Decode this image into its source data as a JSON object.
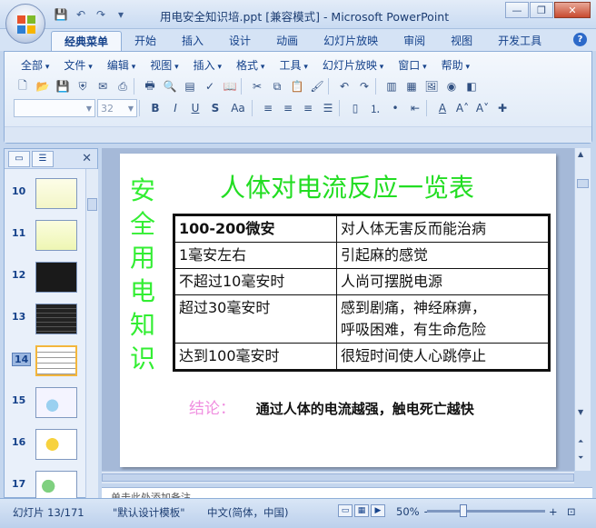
{
  "window": {
    "title": "用电安全知识培.ppt [兼容模式] - Microsoft PowerPoint"
  },
  "qat": {
    "save": "💾",
    "undo": "↶",
    "redo": "↷",
    "more": "▾"
  },
  "tabs": [
    "经典菜单",
    "开始",
    "插入",
    "设计",
    "动画",
    "幻灯片放映",
    "审阅",
    "视图",
    "开发工具"
  ],
  "menus": [
    "全部",
    "文件",
    "编辑",
    "视图",
    "插入",
    "格式",
    "工具",
    "幻灯片放映",
    "窗口",
    "帮助"
  ],
  "font_size_value": "32",
  "help": "?",
  "thumbnails": [
    {
      "num": "10",
      "selected": false,
      "style": "yellow"
    },
    {
      "num": "11",
      "selected": false,
      "style": "yellow"
    },
    {
      "num": "12",
      "selected": false,
      "style": "dark"
    },
    {
      "num": "13",
      "selected": false,
      "style": "dark-table"
    },
    {
      "num": "14",
      "selected": true,
      "style": "table"
    },
    {
      "num": "15",
      "selected": false,
      "style": "figure"
    },
    {
      "num": "16",
      "selected": false,
      "style": "figure2"
    },
    {
      "num": "17",
      "selected": false,
      "style": "figure3"
    }
  ],
  "slide": {
    "vertical_title": [
      "安",
      "全",
      "用",
      "电",
      "知",
      "识"
    ],
    "title": "人体对电流反应一览表",
    "table": [
      {
        "c1": "100-200微安",
        "c2": "对人体无害反而能治病",
        "bold": true
      },
      {
        "c1": "1毫安左右",
        "c2": "引起麻的感觉",
        "bold": false
      },
      {
        "c1": "不超过10毫安时",
        "c2": "人尚可摆脱电源",
        "bold": false
      },
      {
        "c1": "超过30毫安时",
        "c2": "感到剧痛，神经麻痹，",
        "c2b": "呼吸困难，有生命危险",
        "bold": false
      },
      {
        "c1": "达到100毫安时",
        "c2": "很短时间使人心跳停止",
        "bold": false
      }
    ],
    "conclusion_label": "结论：",
    "conclusion_text": "通过人体的电流越强，触电死亡越快"
  },
  "notes_placeholder": "单击此处添加备注",
  "status": {
    "slide_info": "幻灯片 13/171",
    "theme": "\"默认设计模板\"",
    "language": "中文(简体，中国)",
    "zoom": "50%",
    "zoom_minus": "−",
    "zoom_plus": "+"
  },
  "colors": {
    "slide_title": "#22dd22",
    "conclusion_label": "#f08fe0"
  }
}
